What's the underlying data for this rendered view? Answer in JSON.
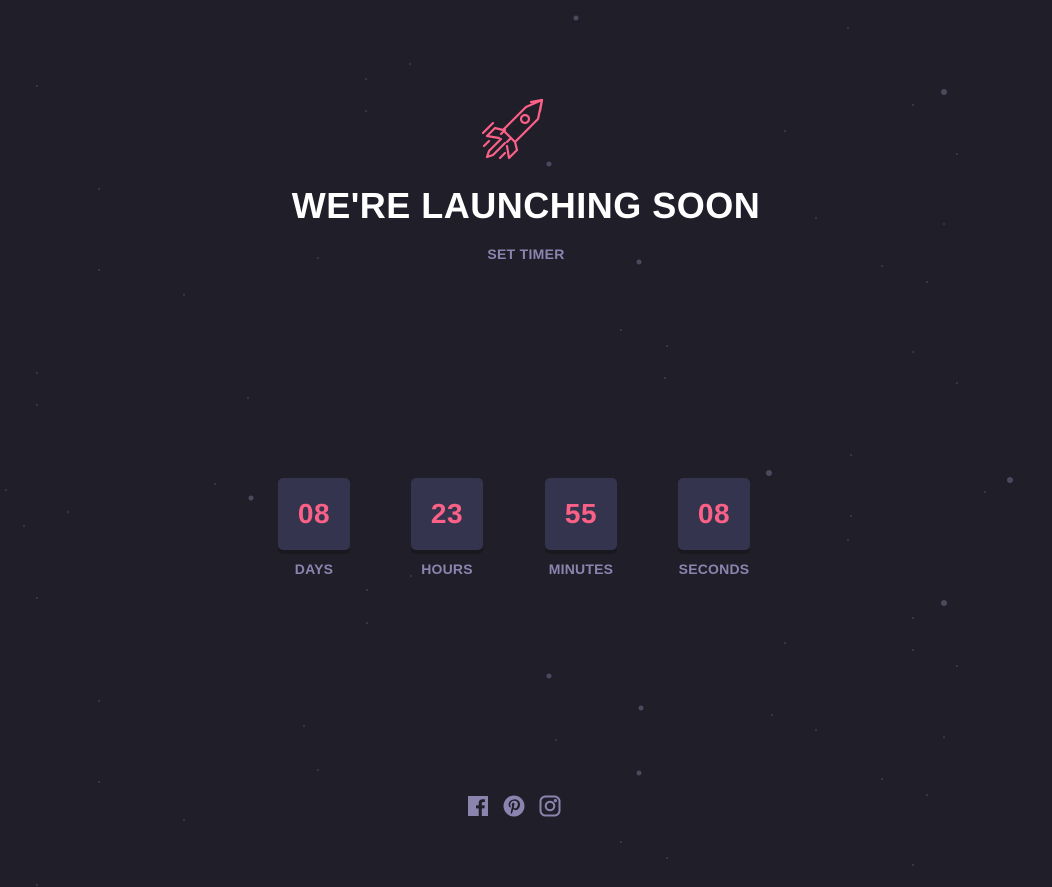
{
  "page": {
    "title": "WE'RE LAUNCHING SOON",
    "subtitle": "SET TIMER"
  },
  "countdown": [
    {
      "value": "08",
      "label": "DAYS"
    },
    {
      "value": "23",
      "label": "HOURS"
    },
    {
      "value": "55",
      "label": "MINUTES"
    },
    {
      "value": "08",
      "label": "SECONDS"
    }
  ],
  "social": [
    {
      "icon": "facebook-icon"
    },
    {
      "icon": "pinterest-icon"
    },
    {
      "icon": "instagram-icon"
    }
  ],
  "colors": {
    "background": "#1f1e29",
    "accent": "#fb6087",
    "muted": "#8a84ae",
    "card": "#34344e"
  }
}
